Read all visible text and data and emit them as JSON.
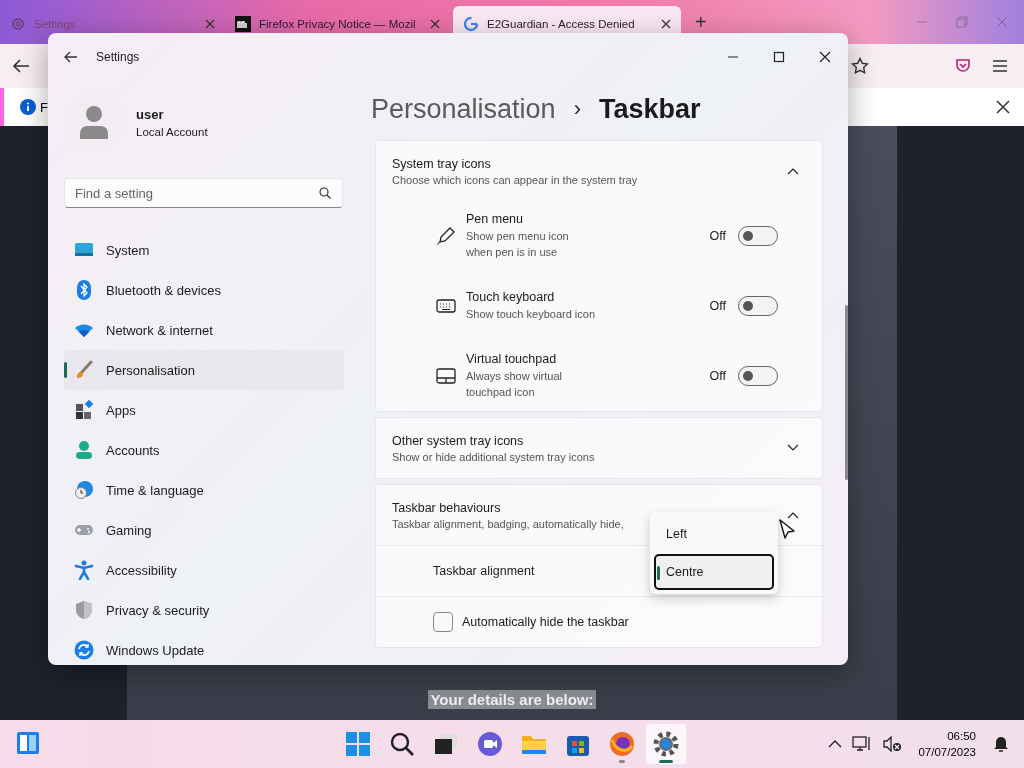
{
  "browser": {
    "tabs": [
      {
        "title": "Settings",
        "selected": false
      },
      {
        "title": "Firefox Privacy Notice — Mozil",
        "selected": false
      },
      {
        "title": "E2Guardian - Access Denied",
        "selected": true
      }
    ],
    "new_tab": "+",
    "notification": {
      "text": "F"
    },
    "page": {
      "text": "Your details are below:"
    }
  },
  "settings": {
    "title": "Settings",
    "user": {
      "name": "user",
      "account": "Local Account"
    },
    "search": {
      "placeholder": "Find a setting"
    },
    "nav": [
      {
        "label": "System",
        "selected": false
      },
      {
        "label": "Bluetooth & devices",
        "selected": false
      },
      {
        "label": "Network & internet",
        "selected": false
      },
      {
        "label": "Personalisation",
        "selected": true
      },
      {
        "label": "Apps",
        "selected": false
      },
      {
        "label": "Accounts",
        "selected": false
      },
      {
        "label": "Time & language",
        "selected": false
      },
      {
        "label": "Gaming",
        "selected": false
      },
      {
        "label": "Accessibility",
        "selected": false
      },
      {
        "label": "Privacy & security",
        "selected": false
      },
      {
        "label": "Windows Update",
        "selected": false
      }
    ],
    "breadcrumb": {
      "parent": "Personalisation",
      "separator": "›",
      "current": "Taskbar"
    },
    "sections": [
      {
        "title": "System tray icons",
        "subtitle": "Choose which icons can appear in the system tray",
        "expanded": true,
        "items": [
          {
            "kind": "toggle",
            "label": "Pen menu",
            "description": "Show pen menu icon when pen is in use",
            "state": "Off",
            "on": false
          },
          {
            "kind": "toggle",
            "label": "Touch keyboard",
            "description": "Show touch keyboard icon",
            "state": "Off",
            "on": false
          },
          {
            "kind": "toggle",
            "label": "Virtual touchpad",
            "description": "Always show virtual touchpad icon",
            "state": "Off",
            "on": false
          }
        ]
      },
      {
        "title": "Other system tray icons",
        "subtitle": "Show or hide additional system tray icons",
        "expanded": false
      },
      {
        "title": "Taskbar behaviours",
        "subtitle": "Taskbar alignment, badging, automatically hide,",
        "expanded": true,
        "items": [
          {
            "kind": "select",
            "label": "Taskbar alignment",
            "options": [
              {
                "label": "Left",
                "selected": false
              },
              {
                "label": "Centre",
                "selected": true
              }
            ]
          },
          {
            "kind": "checkbox",
            "label": "Automatically hide the taskbar",
            "checked": false
          }
        ]
      }
    ]
  },
  "taskbar": {
    "apps": [
      {
        "running": false,
        "selected": false
      },
      {
        "running": false,
        "selected": false
      },
      {
        "running": false,
        "selected": false
      },
      {
        "running": false,
        "selected": false
      },
      {
        "running": false,
        "selected": false
      },
      {
        "running": false,
        "selected": false
      },
      {
        "running": true,
        "selected": false
      },
      {
        "running": true,
        "selected": true
      }
    ],
    "time": "06:50",
    "date": "07/07/2023"
  }
}
